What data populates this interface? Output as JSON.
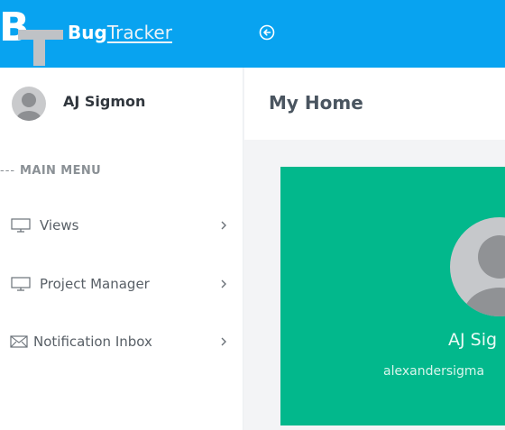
{
  "app": {
    "logo_letters": "BT",
    "brand_bold": "Bug",
    "brand_link": "Tracker"
  },
  "topbar": {
    "toggle_icon": "circle-arrow-left-icon"
  },
  "user": {
    "name": "AJ Sigmon"
  },
  "sidebar": {
    "heading_prefix": "---",
    "heading": "MAIN MENU",
    "items": [
      {
        "label": "Views",
        "icon": "monitor-icon"
      },
      {
        "label": "Project Manager",
        "icon": "monitor-icon"
      },
      {
        "label": "Notification Inbox",
        "icon": "envelope-icon"
      }
    ]
  },
  "main": {
    "title": "My Home"
  },
  "profile_card": {
    "name": "AJ Sig",
    "email": "alexandersigma",
    "color": "#02b88c"
  },
  "colors": {
    "topbar": "#08a3f0",
    "sidebar": "#ffffff",
    "card": "#02b88c"
  }
}
